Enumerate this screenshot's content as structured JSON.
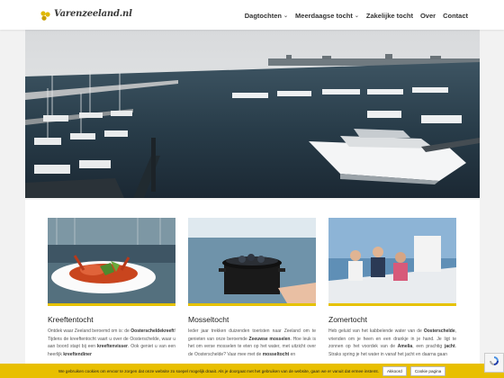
{
  "header": {
    "logo_text": "Varenzeeland.nl",
    "nav": [
      {
        "label": "Dagtochten",
        "dropdown": true
      },
      {
        "label": "Meerdaagse tocht",
        "dropdown": true
      },
      {
        "label": "Zakelijke tocht",
        "dropdown": false
      },
      {
        "label": "Over",
        "dropdown": false
      },
      {
        "label": "Contact",
        "dropdown": false
      }
    ]
  },
  "cards": [
    {
      "title": "Kreeftentocht",
      "text_parts": [
        "Ontdek waar Zeeland beroemd om is: de ",
        "Oosterscheldekreeft",
        "! Tijdens de kreeftentocht vaart u over de Oosterschelde, waar u aan boord stapt bij een ",
        "kreeftenvisser",
        ". Ook geniet u van een heerlijk ",
        "kreeftendiner"
      ]
    },
    {
      "title": "Mosseltocht",
      "text_parts": [
        "Ieder jaar trekken duizenden toeristen naar Zeeland om te genieten van onze beroemde ",
        "Zeeuwse mosselen",
        ". Hoe leuk is het om verse mosselen te eten op het water, met uitzicht over de Oosterschelde? Vaar mee met de ",
        "mosseltocht",
        " en"
      ]
    },
    {
      "title": "Zomertocht",
      "text_parts": [
        "Heb geluid van het kabbelende water van de ",
        "Oosterschelde",
        ", vrienden om je heen en een drankje in je hand. Je ligt te zonnen op het voordek van de ",
        "Amelia",
        ", een prachtig ",
        "jacht",
        ". Straks spring je het water in vanaf het jacht en daarna gaan"
      ]
    }
  ],
  "cookie": {
    "text": "We gebruiken cookies om ervoor te zorgen dat onze website zo soepel mogelijk draait. Als je doorgaat met het gebruiken van de website, gaan we er vanuit dat ermee instemt.",
    "accept": "Akkoord",
    "policy": "Cookie pagina"
  },
  "colors": {
    "accent": "#e6c200",
    "cookie_bg": "#e8bf00",
    "text": "#333333"
  },
  "icons": {
    "logo": "three-dots-logo-icon",
    "dropdown": "chevron-down-icon",
    "recaptcha": "recaptcha-icon"
  }
}
